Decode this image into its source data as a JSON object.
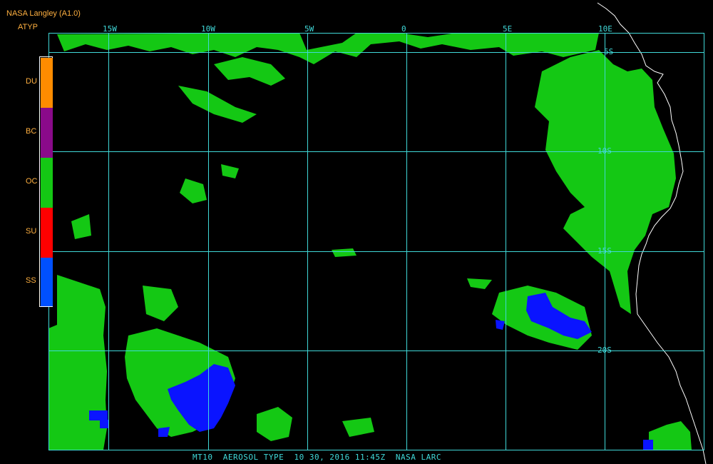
{
  "header": {
    "source": "NASA Langley (A1.0)",
    "product": "ATYP"
  },
  "legend": {
    "items": [
      {
        "code": "DU",
        "color": "#ff8c00"
      },
      {
        "code": "BC",
        "color": "#8a0a8a"
      },
      {
        "code": "OC",
        "color": "#14c814"
      },
      {
        "code": "SU",
        "color": "#ff0000"
      },
      {
        "code": "SS",
        "color": "#0050ff"
      }
    ]
  },
  "axes": {
    "longitude_labels": [
      "15W",
      "10W",
      "5W",
      "0",
      "5E",
      "10E"
    ],
    "latitude_labels": [
      "5S",
      "10S",
      "15S",
      "20S"
    ]
  },
  "colors": {
    "grid": "#40d8d8",
    "coast": "#ffffff",
    "organic_carbon": "#14c814",
    "sea_salt": "#0a14ff",
    "background": "#000000"
  },
  "footer": "MT10  AEROSOL TYPE  10 30, 2016 11:45Z  NASA LARC"
}
